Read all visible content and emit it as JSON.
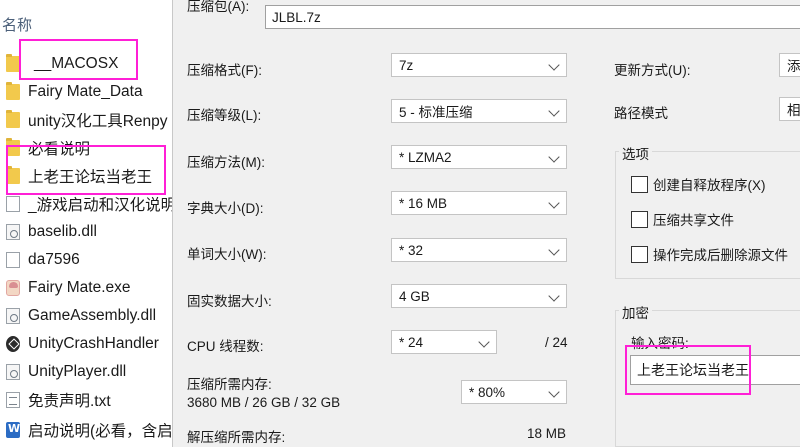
{
  "explorer": {
    "column_header": "名称",
    "items": [
      {
        "name": "__MACOSX",
        "icon": "folder-icon"
      },
      {
        "name": "Fairy Mate_Data",
        "icon": "folder-icon"
      },
      {
        "name": "unity汉化工具Renpy",
        "icon": "folder-icon"
      },
      {
        "name": "必看说明",
        "icon": "folder-icon"
      },
      {
        "name": "上老王论坛当老王",
        "icon": "folder-icon"
      },
      {
        "name": "_游戏启动和汉化说明",
        "icon": "file-icon"
      },
      {
        "name": "baselib.dll",
        "icon": "dll-icon"
      },
      {
        "name": "da7596",
        "icon": "file-icon"
      },
      {
        "name": "Fairy Mate.exe",
        "icon": "exe-icon"
      },
      {
        "name": "GameAssembly.dll",
        "icon": "dll-icon"
      },
      {
        "name": "UnityCrashHandler",
        "icon": "unity-icon"
      },
      {
        "name": "UnityPlayer.dll",
        "icon": "dll-icon"
      },
      {
        "name": "免责声明.txt",
        "icon": "txt-icon"
      },
      {
        "name": "启动说明(必看，含启",
        "icon": "doc-icon"
      }
    ]
  },
  "dialog": {
    "archive_label": "压缩包(A):",
    "archive_value": "JLBL.7z",
    "format_label": "压缩格式(F):",
    "format_value": "7z",
    "level_label": "压缩等级(L):",
    "level_value": "5 - 标准压缩",
    "method_label": "压缩方法(M):",
    "method_value": "* LZMA2",
    "dict_label": "字典大小(D):",
    "dict_value": "* 16 MB",
    "word_label": "单词大小(W):",
    "word_value": "* 32",
    "solid_label": "固实数据大小:",
    "solid_value": "4 GB",
    "threads_label": "CPU 线程数:",
    "threads_value": "* 24",
    "threads_max": "/ 24",
    "mem_label": "压缩所需内存:",
    "mem_value": "3680 MB / 26 GB / 32 GB",
    "mem_percent": "* 80%",
    "decomp_label": "解压缩所需内存:",
    "decomp_value": "18 MB",
    "update_label": "更新方式(U):",
    "update_value": "添",
    "path_label": "路径模式",
    "path_value": "相",
    "options_title": "选项",
    "opt_sfx": "创建自释放程序(X)",
    "opt_shared": "压缩共享文件",
    "opt_delete": "操作完成后删除源文件",
    "encrypt_title": "加密",
    "password_label": "输入密码:",
    "password_value": "上老王论坛当老王"
  },
  "colors": {
    "highlight": "#ff1fd6",
    "folder": "#f2c94c"
  }
}
